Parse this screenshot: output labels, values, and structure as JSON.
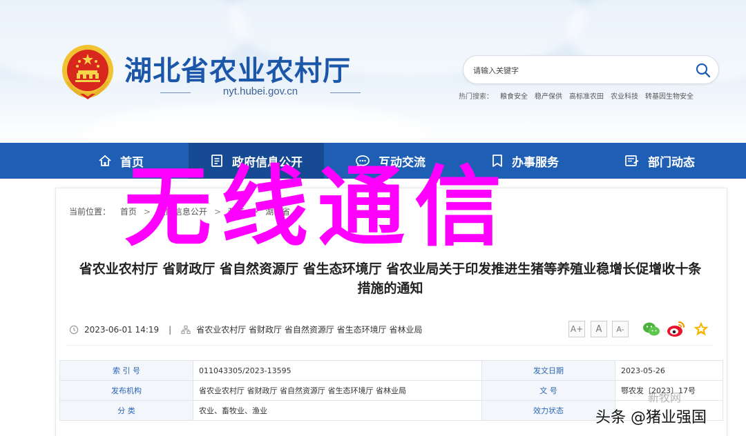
{
  "header": {
    "site_title": "湖北省农业农村厅",
    "domain": "nyt.hubei.gov.cn",
    "search_placeholder": "请输入关键字",
    "hot_label": "热门搜索：",
    "hot_items": [
      "粮食安全",
      "稳产保供",
      "高标准农田",
      "农业科技",
      "转基因生物安全"
    ]
  },
  "nav": {
    "items": [
      {
        "label": "首页",
        "icon": "home-icon"
      },
      {
        "label": "政府信息公开",
        "icon": "document-icon"
      },
      {
        "label": "互动交流",
        "icon": "chat-icon"
      },
      {
        "label": "办事服务",
        "icon": "bookmark-icon"
      },
      {
        "label": "部门动态",
        "icon": "news-icon"
      }
    ],
    "active": "政府信息公开"
  },
  "breadcrumb": {
    "label": "当前位置：",
    "items": [
      "首页",
      "政府信息公开",
      "政策",
      "湖北省"
    ]
  },
  "article": {
    "title_line1": "省农业农村厅 省财政厅 省自然资源厅 省生态环境厅 省农业局关于印发推进生猪等养殖业稳增长促增收十条",
    "title_line2": "措施的通知",
    "date": "2023-06-01 14:19",
    "orgs": "省农业农村厅 省财政厅 省自然资源厅 省生态环境厅 省林业局"
  },
  "font_buttons": [
    "A+",
    "A",
    "A-"
  ],
  "share_icons": [
    "wechat-icon",
    "weibo-icon",
    "favorite-icon"
  ],
  "info_table": {
    "rows": [
      {
        "l1": "索 引 号",
        "v1": "011043305/2023-13595",
        "l2": "发文日期",
        "v2": "2023-05-26"
      },
      {
        "l1": "发布机构",
        "v1": "省农业农村厅 省财政厅 省自然资源厅 省生态环境厅 省林业局",
        "l2": "文      号",
        "v2": "鄂农发〔2023〕17号"
      },
      {
        "l1": "分      类",
        "v1": "农业、畜牧业、渔业",
        "l2": "效力状态",
        "v2": ""
      }
    ]
  },
  "overlay": {
    "big_text": "无线通信",
    "watermark": "头条 @猪业强国",
    "watermark_small": "新牧网"
  },
  "colors": {
    "nav_bg": "#1e5fb5",
    "nav_active": "#164a92",
    "title_blue": "#1c56a8",
    "overlay_magenta": "#ff00ff"
  }
}
